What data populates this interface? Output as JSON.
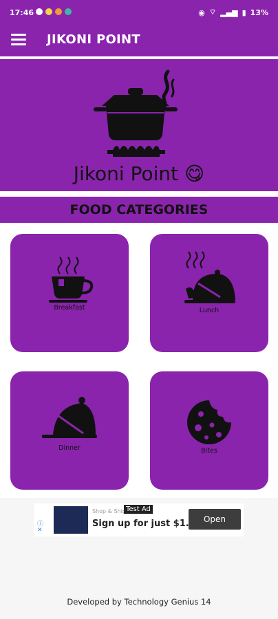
{
  "status_bar": {
    "time": "17:46",
    "battery": "13%"
  },
  "app_bar": {
    "menu_icon": "hamburger-menu-icon",
    "title": "JIKONI POINT"
  },
  "banner": {
    "text": "Jikoni Point 😋",
    "icon": "cooking-pot-on-stove-icon"
  },
  "categories_header": "FOOD CATEGORIES",
  "categories": [
    {
      "label": "Breakfast",
      "icon": "teacup-icon"
    },
    {
      "label": "Lunch",
      "icon": "steaming-cloche-icon"
    },
    {
      "label": "Dinner",
      "icon": "cloche-icon"
    },
    {
      "label": "Bites",
      "icon": "cookie-icon"
    }
  ],
  "ad": {
    "tag": "Test Ad",
    "sub_text": "Shop & Ship",
    "headline": "Sign up for just $1.",
    "button": "Open"
  },
  "footer": "Developed by Technology Genius 14",
  "colors": {
    "primary": "#8a24ad",
    "text_dark": "#111111"
  }
}
